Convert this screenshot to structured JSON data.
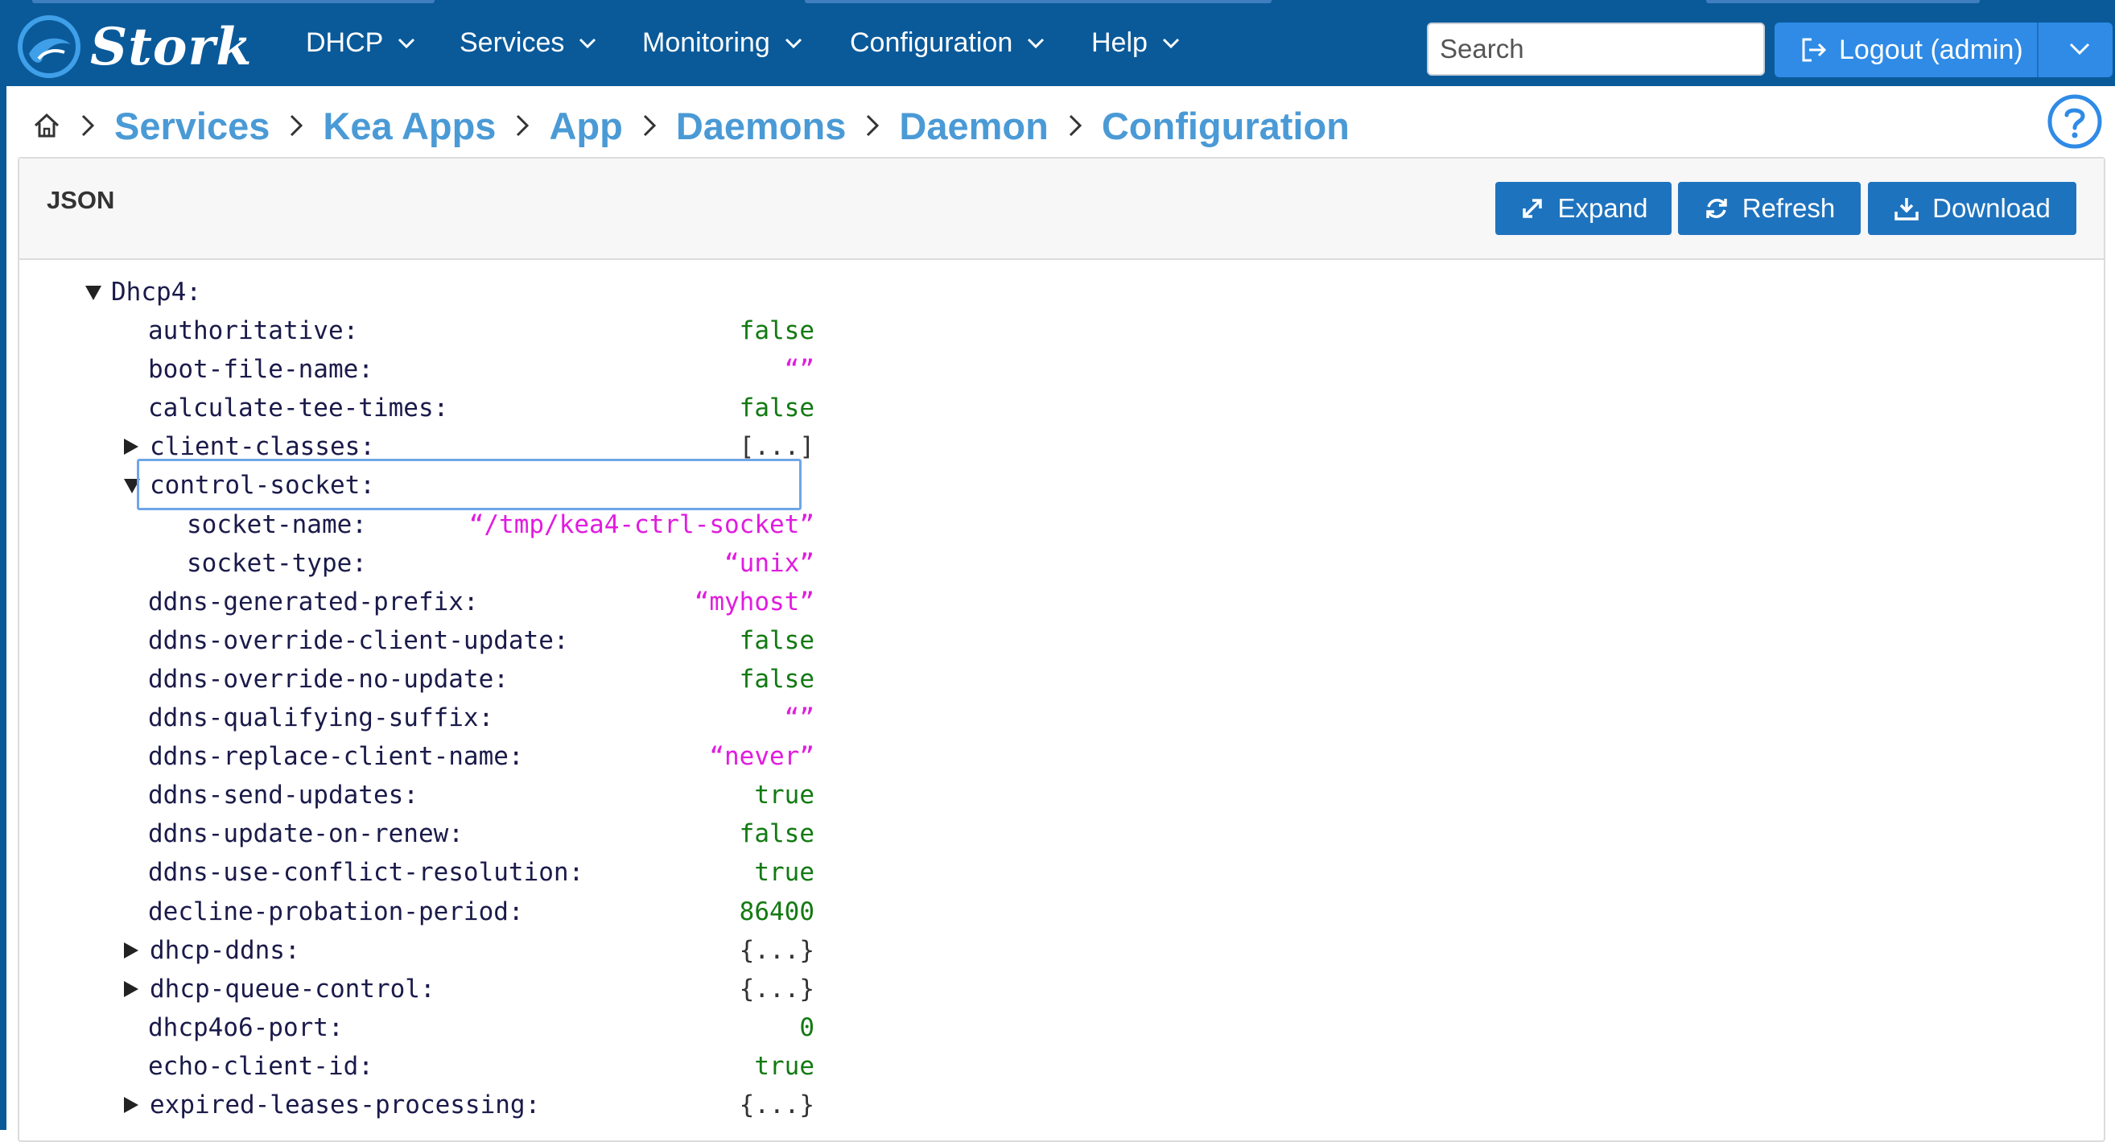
{
  "app": {
    "brand": "Stork"
  },
  "nav": {
    "menus": [
      "DHCP",
      "Services",
      "Monitoring",
      "Configuration",
      "Help"
    ],
    "search_placeholder": "Search",
    "logout_label": "Logout (admin)"
  },
  "breadcrumb": [
    "Services",
    "Kea Apps",
    "App",
    "Daemons",
    "Daemon",
    "Configuration"
  ],
  "panel": {
    "title": "JSON",
    "buttons": {
      "expand": "Expand",
      "refresh": "Refresh",
      "download": "Download"
    }
  },
  "tree": {
    "root": {
      "key": "Dhcp4:",
      "expanded": true
    },
    "rows": [
      {
        "key": "authoritative:",
        "value": "false",
        "type": "bool",
        "level": 1
      },
      {
        "key": "boot-file-name:",
        "value": "“”",
        "type": "str",
        "level": 1
      },
      {
        "key": "calculate-tee-times:",
        "value": "false",
        "type": "bool",
        "level": 1
      },
      {
        "key": "client-classes:",
        "value": "[...]",
        "type": "coll",
        "level": 1,
        "expandable": true,
        "expanded": false
      },
      {
        "key": "control-socket:",
        "value": "",
        "type": "coll",
        "level": 1,
        "expandable": true,
        "expanded": true,
        "focused": true
      },
      {
        "key": "socket-name:",
        "value": "“/tmp/kea4-ctrl-socket”",
        "type": "str",
        "level": 2
      },
      {
        "key": "socket-type:",
        "value": "“unix”",
        "type": "str",
        "level": 2
      },
      {
        "key": "ddns-generated-prefix:",
        "value": "“myhost”",
        "type": "str",
        "level": 1
      },
      {
        "key": "ddns-override-client-update:",
        "value": "false",
        "type": "bool",
        "level": 1
      },
      {
        "key": "ddns-override-no-update:",
        "value": "false",
        "type": "bool",
        "level": 1
      },
      {
        "key": "ddns-qualifying-suffix:",
        "value": "“”",
        "type": "str",
        "level": 1
      },
      {
        "key": "ddns-replace-client-name:",
        "value": "“never”",
        "type": "str",
        "level": 1
      },
      {
        "key": "ddns-send-updates:",
        "value": "true",
        "type": "bool",
        "level": 1
      },
      {
        "key": "ddns-update-on-renew:",
        "value": "false",
        "type": "bool",
        "level": 1
      },
      {
        "key": "ddns-use-conflict-resolution:",
        "value": "true",
        "type": "bool",
        "level": 1
      },
      {
        "key": "decline-probation-period:",
        "value": "86400",
        "type": "num",
        "level": 1
      },
      {
        "key": "dhcp-ddns:",
        "value": "{...}",
        "type": "coll",
        "level": 1,
        "expandable": true,
        "expanded": false
      },
      {
        "key": "dhcp-queue-control:",
        "value": "{...}",
        "type": "coll",
        "level": 1,
        "expandable": true,
        "expanded": false
      },
      {
        "key": "dhcp4o6-port:",
        "value": "0",
        "type": "num",
        "level": 1
      },
      {
        "key": "echo-client-id:",
        "value": "true",
        "type": "bool",
        "level": 1
      },
      {
        "key": "expired-leases-processing:",
        "value": "{...}",
        "type": "coll",
        "level": 1,
        "expandable": true,
        "expanded": false
      }
    ]
  },
  "colors": {
    "navbar": "#0a5a9a",
    "accent_button": "#1e73be",
    "breadcrumb_link": "#4a9ad6",
    "json_bool_number": "#127a12",
    "json_string": "#e11be0",
    "json_key": "#1a1a4a",
    "focus_outline": "#6ea6e8"
  },
  "icons": {
    "brand": "stork-logo-icon",
    "home": "home-icon",
    "separator": "chevron-right-icon",
    "help": "help-circle-icon",
    "logout": "logout-icon",
    "expand": "expand-arrows-icon",
    "refresh": "refresh-icon",
    "download": "download-icon"
  }
}
